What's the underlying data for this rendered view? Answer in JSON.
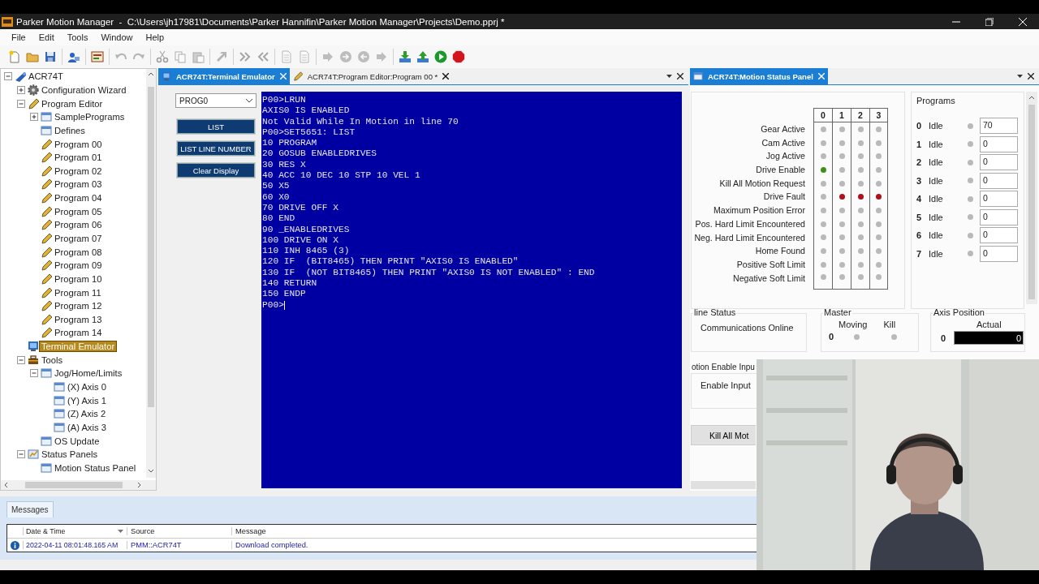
{
  "window": {
    "title": "Parker Motion Manager  -  C:\\Users\\jh17981\\Documents\\Parker Hannifin\\Parker Motion Manager\\Projects\\Demo.pprj *"
  },
  "menu": [
    "File",
    "Edit",
    "Tools",
    "Window",
    "Help"
  ],
  "toolbar": [
    {
      "kind": "new",
      "disabled": false
    },
    {
      "kind": "open",
      "disabled": false
    },
    {
      "kind": "save",
      "disabled": false
    },
    {
      "kind": "separator"
    },
    {
      "kind": "connect",
      "disabled": false
    },
    {
      "kind": "separator"
    },
    {
      "kind": "terminal",
      "disabled": false
    },
    {
      "kind": "separator"
    },
    {
      "kind": "undo",
      "disabled": true
    },
    {
      "kind": "redo",
      "disabled": true
    },
    {
      "kind": "separator"
    },
    {
      "kind": "cut",
      "disabled": true
    },
    {
      "kind": "copy",
      "disabled": true
    },
    {
      "kind": "paste",
      "disabled": true
    },
    {
      "kind": "separator"
    },
    {
      "kind": "format",
      "disabled": true
    },
    {
      "kind": "separator"
    },
    {
      "kind": "indent",
      "disabled": true
    },
    {
      "kind": "outdent",
      "disabled": true
    },
    {
      "kind": "separator"
    },
    {
      "kind": "doc",
      "disabled": true
    },
    {
      "kind": "doc",
      "disabled": true
    },
    {
      "kind": "separator"
    },
    {
      "kind": "arrow",
      "disabled": true
    },
    {
      "kind": "circle-right",
      "disabled": true
    },
    {
      "kind": "circle-left",
      "disabled": true
    },
    {
      "kind": "arrow",
      "disabled": true
    },
    {
      "kind": "separator"
    },
    {
      "kind": "download",
      "disabled": false
    },
    {
      "kind": "upload",
      "disabled": false
    },
    {
      "kind": "run",
      "disabled": false
    },
    {
      "kind": "stop",
      "disabled": false
    }
  ],
  "tree": [
    {
      "label": "ACR74T",
      "kind": "controller",
      "expanded": true,
      "selected": false,
      "children": [
        {
          "label": "Configuration Wizard",
          "kind": "gear",
          "expanded": false,
          "selected": false
        },
        {
          "label": "Program Editor",
          "kind": "pencil",
          "expanded": true,
          "selected": false,
          "children": [
            {
              "label": "SamplePrograms",
              "kind": "window",
              "expanded": false,
              "selected": false
            },
            {
              "label": "Defines",
              "kind": "window",
              "selected": false
            },
            {
              "label": "Program 00",
              "kind": "pencil",
              "selected": false
            },
            {
              "label": "Program 01",
              "kind": "pencil",
              "selected": false
            },
            {
              "label": "Program 02",
              "kind": "pencil",
              "selected": false
            },
            {
              "label": "Program 03",
              "kind": "pencil",
              "selected": false
            },
            {
              "label": "Program 04",
              "kind": "pencil",
              "selected": false
            },
            {
              "label": "Program 05",
              "kind": "pencil",
              "selected": false
            },
            {
              "label": "Program 06",
              "kind": "pencil",
              "selected": false
            },
            {
              "label": "Program 07",
              "kind": "pencil",
              "selected": false
            },
            {
              "label": "Program 08",
              "kind": "pencil",
              "selected": false
            },
            {
              "label": "Program 09",
              "kind": "pencil",
              "selected": false
            },
            {
              "label": "Program 10",
              "kind": "pencil",
              "selected": false
            },
            {
              "label": "Program 11",
              "kind": "pencil",
              "selected": false
            },
            {
              "label": "Program 12",
              "kind": "pencil",
              "selected": false
            },
            {
              "label": "Program 13",
              "kind": "pencil",
              "selected": false
            },
            {
              "label": "Program 14",
              "kind": "pencil",
              "selected": false
            }
          ]
        },
        {
          "label": "Terminal Emulator",
          "kind": "terminal",
          "selected": true
        },
        {
          "label": "Tools",
          "kind": "toolbox",
          "expanded": true,
          "selected": false,
          "children": [
            {
              "label": "Jog/Home/Limits",
              "kind": "window",
              "expanded": true,
              "selected": false,
              "children": [
                {
                  "label": "(X) Axis 0",
                  "kind": "window",
                  "selected": false
                },
                {
                  "label": "(Y) Axis 1",
                  "kind": "window",
                  "selected": false
                },
                {
                  "label": "(Z) Axis 2",
                  "kind": "window",
                  "selected": false
                },
                {
                  "label": "(A) Axis 3",
                  "kind": "window",
                  "selected": false
                }
              ]
            },
            {
              "label": "OS Update",
              "kind": "window",
              "selected": false
            }
          ]
        },
        {
          "label": "Status Panels",
          "kind": "status",
          "expanded": true,
          "selected": false,
          "children": [
            {
              "label": "Motion Status Panel",
              "kind": "window",
              "selected": false
            }
          ]
        }
      ]
    }
  ],
  "documents": {
    "tabs": [
      {
        "label": "ACR74T:Terminal Emulator",
        "selected": true
      },
      {
        "label": "ACR74T:Program Editor:Program 00 *",
        "selected": false
      }
    ]
  },
  "terminal_controls": {
    "program": "PROG0",
    "buttons": [
      "LIST",
      "LIST LINE NUMBER",
      "Clear Display"
    ]
  },
  "terminal": {
    "lines": [
      "P00>LRUN",
      "AXIS0 IS ENABLED",
      "Not Valid While In Motion in line 70",
      "P00>SET5651: LIST",
      "10 PROGRAM",
      "20 GOSUB ENABLEDRIVES",
      "30 RES X",
      "40 ACC 10 DEC 10 STP 10 VEL 1",
      "50 X5",
      "60 X0",
      "70 DRIVE OFF X",
      "80 END",
      "90 _ENABLEDRIVES",
      "100 DRIVE ON X",
      "110 INH 8465 (3)",
      "120 IF  (BIT8465) THEN PRINT \"AXIS0 IS ENABLED\"",
      "130 IF  (NOT BIT8465) THEN PRINT \"AXIS0 IS NOT ENABLED\" : END",
      "140 RETURN",
      "150 ENDP",
      "P00>"
    ]
  },
  "status_panel": {
    "tab": {
      "label": "ACR74T:Motion Status Panel",
      "selected": true
    },
    "axes": [
      "0",
      "1",
      "2",
      "3"
    ],
    "rows": [
      {
        "label": "Gear Active",
        "lamps": [
          {
            "color": "#b9b9b9"
          },
          {
            "color": "#b9b9b9"
          },
          {
            "color": "#b9b9b9"
          },
          {
            "color": "#b9b9b9"
          }
        ]
      },
      {
        "label": "Cam Active",
        "lamps": [
          {
            "color": "#b9b9b9"
          },
          {
            "color": "#b9b9b9"
          },
          {
            "color": "#b9b9b9"
          },
          {
            "color": "#b9b9b9"
          }
        ]
      },
      {
        "label": "Jog Active",
        "lamps": [
          {
            "color": "#b9b9b9"
          },
          {
            "color": "#b9b9b9"
          },
          {
            "color": "#b9b9b9"
          },
          {
            "color": "#b9b9b9"
          }
        ]
      },
      {
        "label": "Drive Enable",
        "lamps": [
          {
            "color": "#3f8f12"
          },
          {
            "color": "#b9b9b9"
          },
          {
            "color": "#b9b9b9"
          },
          {
            "color": "#b9b9b9"
          }
        ]
      },
      {
        "label": "Kill All Motion Request",
        "lamps": [
          {
            "color": "#b9b9b9"
          },
          {
            "color": "#b9b9b9"
          },
          {
            "color": "#b9b9b9"
          },
          {
            "color": "#b9b9b9"
          }
        ]
      },
      {
        "label": "Drive Fault",
        "lamps": [
          {
            "color": "#b9b9b9"
          },
          {
            "color": "#b0101a"
          },
          {
            "color": "#b0101a"
          },
          {
            "color": "#b0101a"
          }
        ]
      },
      {
        "label": "Maximum Position Error",
        "lamps": [
          {
            "color": "#b9b9b9"
          },
          {
            "color": "#b9b9b9"
          },
          {
            "color": "#b9b9b9"
          },
          {
            "color": "#b9b9b9"
          }
        ]
      },
      {
        "label": "Pos. Hard Limit Encountered",
        "lamps": [
          {
            "color": "#b9b9b9"
          },
          {
            "color": "#b9b9b9"
          },
          {
            "color": "#b9b9b9"
          },
          {
            "color": "#b9b9b9"
          }
        ]
      },
      {
        "label": "Neg. Hard Limit Encountered",
        "lamps": [
          {
            "color": "#b9b9b9"
          },
          {
            "color": "#b9b9b9"
          },
          {
            "color": "#b9b9b9"
          },
          {
            "color": "#b9b9b9"
          }
        ]
      },
      {
        "label": "Home Found",
        "lamps": [
          {
            "color": "#b9b9b9"
          },
          {
            "color": "#b9b9b9"
          },
          {
            "color": "#b9b9b9"
          },
          {
            "color": "#b9b9b9"
          }
        ]
      },
      {
        "label": "Positive Soft Limit",
        "lamps": [
          {
            "color": "#b9b9b9"
          },
          {
            "color": "#b9b9b9"
          },
          {
            "color": "#b9b9b9"
          },
          {
            "color": "#b9b9b9"
          }
        ]
      },
      {
        "label": "Negative Soft Limit",
        "lamps": [
          {
            "color": "#b9b9b9"
          },
          {
            "color": "#b9b9b9"
          },
          {
            "color": "#b9b9b9"
          },
          {
            "color": "#b9b9b9"
          }
        ]
      }
    ],
    "programs": {
      "legend": "Programs",
      "rows": [
        {
          "number": "0",
          "state": "Idle",
          "color": "#b9b9b9",
          "value": "70"
        },
        {
          "number": "1",
          "state": "Idle",
          "color": "#b9b9b9",
          "value": "0"
        },
        {
          "number": "2",
          "state": "Idle",
          "color": "#b9b9b9",
          "value": "0"
        },
        {
          "number": "3",
          "state": "Idle",
          "color": "#b9b9b9",
          "value": "0"
        },
        {
          "number": "4",
          "state": "Idle",
          "color": "#b9b9b9",
          "value": "0"
        },
        {
          "number": "5",
          "state": "Idle",
          "color": "#b9b9b9",
          "value": "0"
        },
        {
          "number": "6",
          "state": "Idle",
          "color": "#b9b9b9",
          "value": "0"
        },
        {
          "number": "7",
          "state": "Idle",
          "color": "#b9b9b9",
          "value": "0"
        }
      ]
    },
    "online_status": {
      "legend": "line Status",
      "text": "Communications Online"
    },
    "master": {
      "legend": "Master",
      "columns": [
        "Moving",
        "Kill"
      ],
      "rows": [
        {
          "label": "0",
          "lamps": [
            {
              "color": "#b9b9b9"
            },
            {
              "color": "#b9b9b9"
            }
          ]
        }
      ]
    },
    "axis_position": {
      "legend": "Axis Position",
      "column": "Actual",
      "rows": [
        {
          "label": "0",
          "value": "0"
        }
      ]
    },
    "enable_input": {
      "legend": "otion Enable Inpu",
      "text": "Enable Input"
    },
    "kill_button": "Kill All Mot"
  },
  "messages": {
    "tab": "Messages",
    "columns": [
      "Date & Time",
      "Source",
      "Message"
    ],
    "rows": [
      {
        "kind": "info",
        "date": "2022-04-11 08:01:48.165 AM",
        "source": "PMM::ACR74T",
        "message": "Download completed."
      }
    ]
  }
}
